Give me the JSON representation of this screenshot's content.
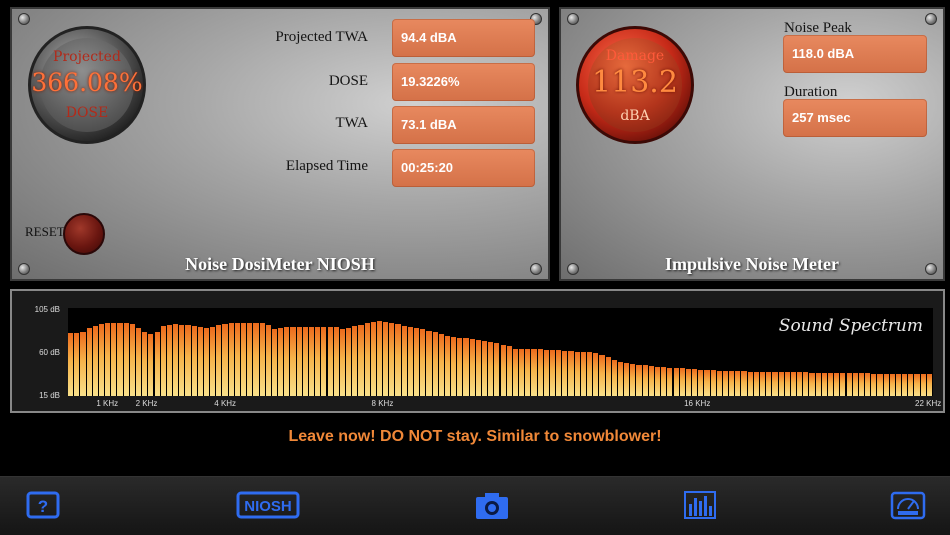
{
  "dosimeter": {
    "gauge_top": "Projected",
    "gauge_value": "366.08%",
    "gauge_bottom": "DOSE",
    "rows": [
      {
        "label": "Projected TWA",
        "value": "94.4 dBA"
      },
      {
        "label": "DOSE",
        "value": "19.3226%"
      },
      {
        "label": "TWA",
        "value": "73.1 dBA"
      },
      {
        "label": "Elapsed Time",
        "value": "00:25:20"
      }
    ],
    "reset_label": "RESET",
    "title": "Noise DosiMeter NIOSH"
  },
  "impulse": {
    "gauge_top": "Damage",
    "gauge_value": "113.2",
    "gauge_bottom": "dBA",
    "peak_label": "Noise Peak",
    "peak_value": "118.0 dBA",
    "duration_label": "Duration",
    "duration_value": "257 msec",
    "title": "Impulsive Noise Meter"
  },
  "chart_data": {
    "type": "bar",
    "title": "Sound Spectrum",
    "y_ticks": [
      "105 dB",
      "60 dB",
      "15 dB"
    ],
    "ylim": [
      15,
      105
    ],
    "x_ticks": [
      {
        "label": "1 KHz",
        "freq": 1
      },
      {
        "label": "2 KHz",
        "freq": 2
      },
      {
        "label": "4 KHz",
        "freq": 4
      },
      {
        "label": "8 KHz",
        "freq": 8
      },
      {
        "label": "16 KHz",
        "freq": 16
      },
      {
        "label": "22 KHz",
        "freq": 22
      }
    ],
    "xlim_khz": [
      0,
      22
    ],
    "values": [
      79,
      79,
      80,
      85,
      87,
      89,
      90,
      90,
      90,
      90,
      89,
      85,
      80,
      78,
      80,
      87,
      88,
      89,
      88,
      88,
      87,
      86,
      85,
      86,
      88,
      89,
      90,
      90,
      90,
      90,
      90,
      90,
      88,
      84,
      85,
      86,
      86,
      86,
      86,
      86,
      86,
      86,
      86,
      86,
      84,
      85,
      87,
      88,
      90,
      91,
      92,
      91,
      90,
      89,
      87,
      86,
      85,
      84,
      82,
      80,
      78,
      76,
      75,
      74,
      74,
      73,
      72,
      71,
      70,
      69,
      67,
      66,
      63,
      63,
      63,
      63,
      63,
      62,
      62,
      62,
      61,
      61,
      60,
      60,
      60,
      59,
      57,
      55,
      52,
      50,
      49,
      48,
      47,
      47,
      46,
      45,
      45,
      44,
      44,
      44,
      43,
      43,
      42,
      42,
      42,
      41,
      41,
      41,
      41,
      41,
      40,
      40,
      40,
      40,
      40,
      40,
      40,
      40,
      40,
      40,
      39,
      39,
      39,
      39,
      39,
      39,
      39,
      39,
      39,
      39,
      38,
      38,
      38,
      38,
      38,
      38,
      38,
      38,
      38,
      38
    ]
  },
  "message": "Leave now! DO NOT stay. Similar to snowblower!",
  "toolbar": {
    "niosh_label": "NIOSH",
    "help_glyph": "?",
    "accent": "#2f6cf0"
  }
}
